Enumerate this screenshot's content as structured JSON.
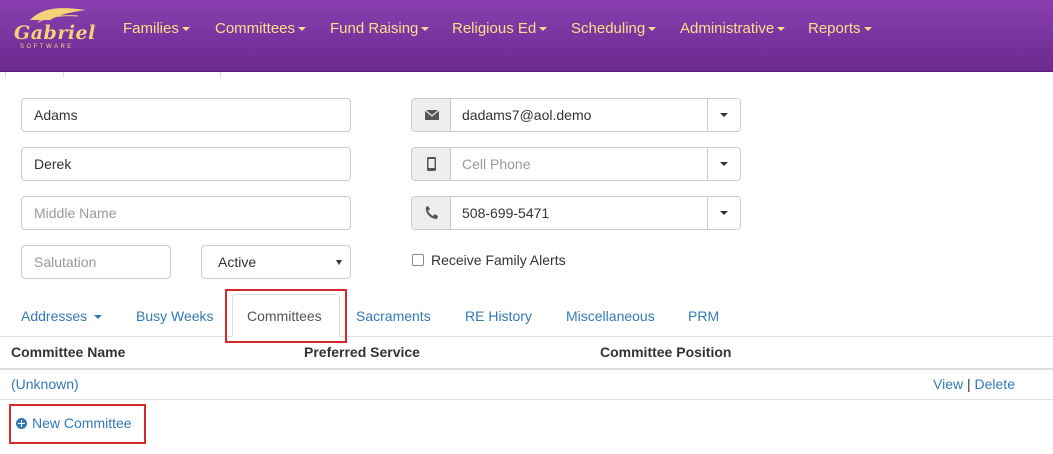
{
  "brand": {
    "name": "Gabriel",
    "sub": "SOFTWARE"
  },
  "nav": [
    "Families",
    "Committees",
    "Fund Raising",
    "Religious Ed",
    "Scheduling",
    "Administrative",
    "Reports"
  ],
  "person": {
    "last_name": "Adams",
    "first_name": "Derek",
    "middle_name_placeholder": "Middle Name",
    "salutation_placeholder": "Salutation",
    "status": "Active",
    "email": "dadams7@aol.demo",
    "cell_phone_placeholder": "Cell Phone",
    "phone": "508-699-5471",
    "receive_alerts_label": "Receive Family Alerts"
  },
  "tabs": [
    "Addresses",
    "Busy Weeks",
    "Committees",
    "Sacraments",
    "RE History",
    "Miscellaneous",
    "PRM"
  ],
  "table": {
    "headers": [
      "Committee Name",
      "Preferred Service",
      "Committee Position"
    ],
    "rows": [
      {
        "name": "(Unknown)",
        "view": "View",
        "sep": "|",
        "delete": "Delete"
      }
    ]
  },
  "new_committee_label": "New Committee",
  "colors": {
    "nav_bg": "#7b35a2",
    "nav_text": "#f7e08a",
    "link": "#337ab7",
    "highlight": "#d9272e"
  }
}
